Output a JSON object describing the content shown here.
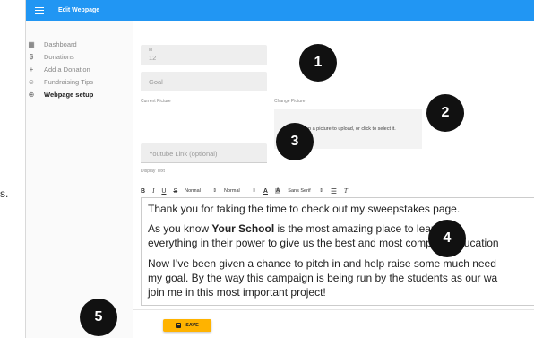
{
  "stray_text": "s.",
  "appbar": {
    "title": "Edit Webpage"
  },
  "sidebar": {
    "items": [
      {
        "label": "Dashboard",
        "icon": "dashboard-icon",
        "glyph": "▦"
      },
      {
        "label": "Donations",
        "icon": "dollar-icon",
        "glyph": "$"
      },
      {
        "label": "Add a Donation",
        "icon": "plus-icon",
        "glyph": "+"
      },
      {
        "label": "Fundraising Tips",
        "icon": "smiley-icon",
        "glyph": "☺"
      },
      {
        "label": "Webpage setup",
        "icon": "globe-icon",
        "glyph": "⊕"
      }
    ],
    "active_index": 4
  },
  "form": {
    "id_label": "id",
    "id_value": "12",
    "goal_placeholder": "Goal",
    "current_picture_label": "Current Picture",
    "change_picture_label": "Change Picture",
    "dropzone_text": "Drop a picture to upload, or click to select it.",
    "youtube_placeholder": "Youtube Link (optional)",
    "display_text_label": "Display Text"
  },
  "toolbar": {
    "bold": "B",
    "italic": "I",
    "underline": "U",
    "strike": "S",
    "heading": "Normal",
    "size": "Normal",
    "font": "Sans Serif",
    "color_a": "A",
    "bg_a": "A",
    "clean": "T"
  },
  "editor": {
    "p1": "Thank you for taking the time to check out my sweepstakes page.",
    "p2a_before": "As you know ",
    "p2a_bold": "Your School",
    "p2a_after": " is the most amazing place to learn and",
    "p2b": "everything in their power to give us the best and most complete education",
    "p3a": "Now I’ve been given a chance to pitch in and help raise some much need",
    "p3b": "my goal. By the way this campaign is being run by the students as our wa",
    "p3c": "join me in this most important project!"
  },
  "save_button": {
    "label": "SAVE"
  },
  "callouts": [
    "1",
    "2",
    "3",
    "4",
    "5"
  ],
  "colors": {
    "appbar": "#2196f3",
    "save": "#ffb300",
    "callout": "#111111"
  }
}
